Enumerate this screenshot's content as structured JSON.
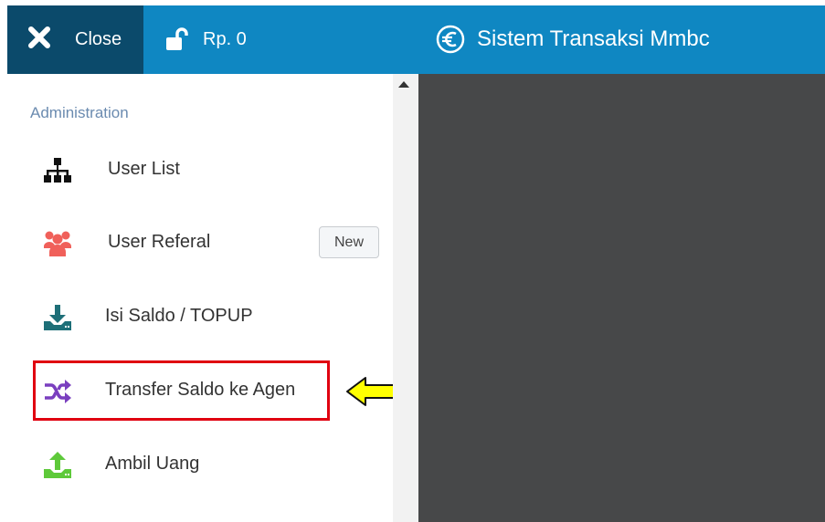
{
  "header": {
    "close_label": "Close",
    "balance": "Rp. 0",
    "app_title": "Sistem Transaksi Mmbc"
  },
  "sidebar": {
    "section_title": "Administration",
    "items": [
      {
        "label": "User List",
        "icon": "sitemap-icon",
        "color": "#111111"
      },
      {
        "label": "User Referal",
        "icon": "users-group-icon",
        "color": "#f0605a",
        "badge": "New"
      },
      {
        "label": "Isi Saldo / TOPUP",
        "icon": "download-tray-icon",
        "color": "#1e6f78"
      },
      {
        "label": "Transfer Saldo ke Agen",
        "icon": "shuffle-icon",
        "color": "#7a3fbf"
      },
      {
        "label": "Ambil Uang",
        "icon": "upload-tray-icon",
        "color": "#5ec93a"
      }
    ]
  },
  "annotations": {
    "highlight_color": "#e00010",
    "arrow_color": "#ffff00"
  },
  "colors": {
    "topbar": "#0f87c2",
    "close_bg": "#0b4a6b",
    "content_bg": "#474849"
  }
}
